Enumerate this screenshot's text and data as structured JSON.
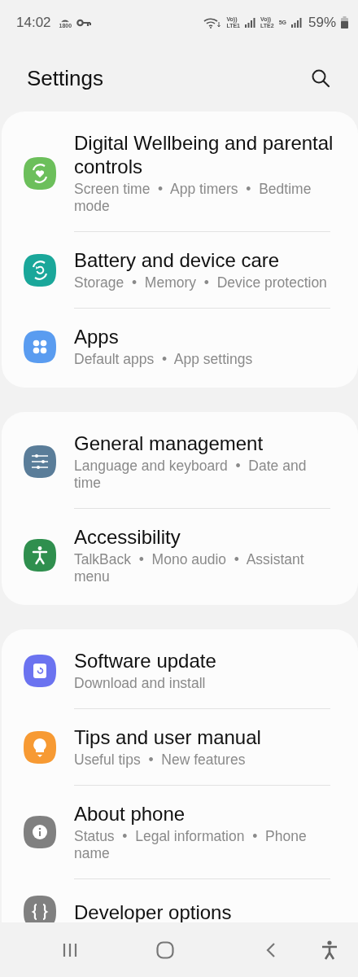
{
  "status_bar": {
    "time": "14:02",
    "hotspot_label": "1800",
    "sim1": {
      "volte": "Vo))",
      "network": "LTE1"
    },
    "sim2": {
      "volte": "Vo))",
      "network": "LTE2",
      "data": "5G"
    },
    "battery": "59%"
  },
  "header": {
    "title": "Settings"
  },
  "sections": [
    {
      "items": [
        {
          "kind": "wellbeing",
          "color": "#6cbf5b",
          "title": "Digital Wellbeing and parental controls",
          "subtitle": "Screen time  •  App timers  •  Bedtime mode"
        },
        {
          "kind": "care",
          "color": "#1aa79a",
          "title": "Battery and device care",
          "subtitle": "Storage  •  Memory  •  Device protection"
        },
        {
          "kind": "apps",
          "color": "#5a9cf0",
          "title": "Apps",
          "subtitle": "Default apps  •  App settings"
        }
      ]
    },
    {
      "items": [
        {
          "kind": "sliders",
          "color": "#5a7d99",
          "title": "General management",
          "subtitle": "Language and keyboard  •  Date and time"
        },
        {
          "kind": "accessibility",
          "color": "#2f8f4e",
          "title": "Accessibility",
          "subtitle": "TalkBack  •  Mono audio  •  Assistant menu"
        }
      ]
    },
    {
      "items": [
        {
          "kind": "update",
          "color": "#6b73f0",
          "title": "Software update",
          "subtitle": "Download and install"
        },
        {
          "kind": "tips",
          "color": "#f79a33",
          "title": "Tips and user manual",
          "subtitle": "Useful tips  •  New features"
        },
        {
          "kind": "info",
          "color": "#808080",
          "title": "About phone",
          "subtitle": "Status  •  Legal information  •  Phone name"
        },
        {
          "kind": "developer",
          "color": "#808080",
          "title": "Developer options"
        }
      ]
    }
  ]
}
